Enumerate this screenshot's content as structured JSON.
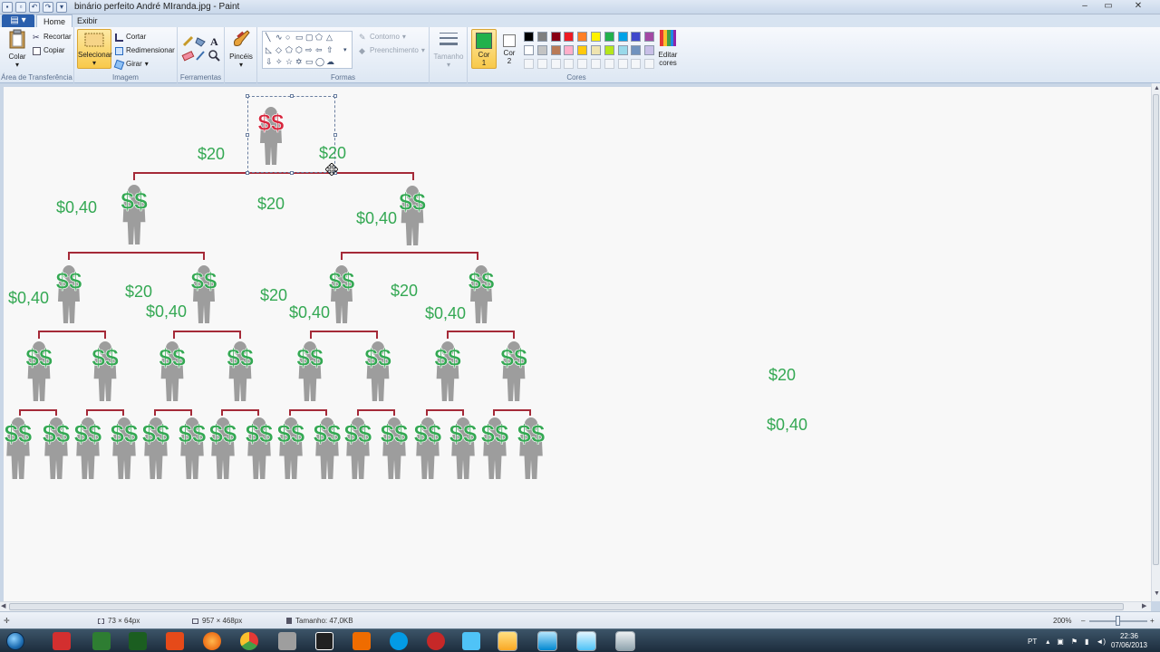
{
  "window": {
    "title": "binário perfeito André MIranda.jpg - Paint",
    "controls": [
      "–",
      "▭",
      "✕"
    ]
  },
  "tabs": {
    "file": "▤ ▾",
    "home": "Home",
    "view": "Exibir"
  },
  "ribbon": {
    "clipboard": {
      "paste": "Colar",
      "cut": "Recortar",
      "copy": "Copiar",
      "label": "Área de Transferência"
    },
    "image": {
      "select": "Selecionar",
      "crop": "Cortar",
      "resize": "Redimensionar",
      "rotate": "Girar",
      "label": "Imagem"
    },
    "tools": {
      "label": "Ferramentas"
    },
    "brushes": {
      "label": "Pincéis"
    },
    "shapes": {
      "outline": "Contorno",
      "fill": "Preenchimento",
      "label": "Formas"
    },
    "size": {
      "label": "Tamanho"
    },
    "colors": {
      "color1": "Cor 1",
      "color2": "Cor 2",
      "edit": "Editar cores",
      "label": "Cores",
      "color1_value": "#22b14c",
      "color2_value": "#ffffff",
      "palette": [
        "#000000",
        "#7f7f7f",
        "#880015",
        "#ed1c24",
        "#ff7f27",
        "#fff200",
        "#22b14c",
        "#00a2e8",
        "#3f48cc",
        "#a349a4",
        "#ffffff",
        "#c3c3c3",
        "#b97a57",
        "#ffaec9",
        "#ffc90e",
        "#efe4b0",
        "#b5e61d",
        "#99d9ea",
        "#7092be",
        "#c8bfe7"
      ]
    }
  },
  "canvas": {
    "top_symbol": "$$",
    "person_symbol": "$$",
    "labels": {
      "l1_left": "$20",
      "l1_right": "$20",
      "l2_left": "$0,40",
      "l2_mid": "$20",
      "l2_right": "$0,40",
      "l3_a": "$0,40",
      "l3_b": "$20",
      "l3_c": "$0,40",
      "l3_d": "$20",
      "l3_e": "$0,40",
      "l3_f": "$20",
      "l3_g": "$0,40",
      "side_a": "$20",
      "side_b": "$0,40"
    }
  },
  "status": {
    "selection_size": "73 × 64px",
    "image_size": "957 × 468px",
    "file_size": "Tamanho: 47,0KB",
    "zoom": "200%"
  },
  "taskbar": {
    "language": "PT",
    "time": "22:36",
    "date": "07/06/2013"
  },
  "colors": {
    "money_green": "#34a853",
    "money_red": "#d7263d",
    "person_gray": "#9d9d9d",
    "line_red": "#a52a38"
  }
}
